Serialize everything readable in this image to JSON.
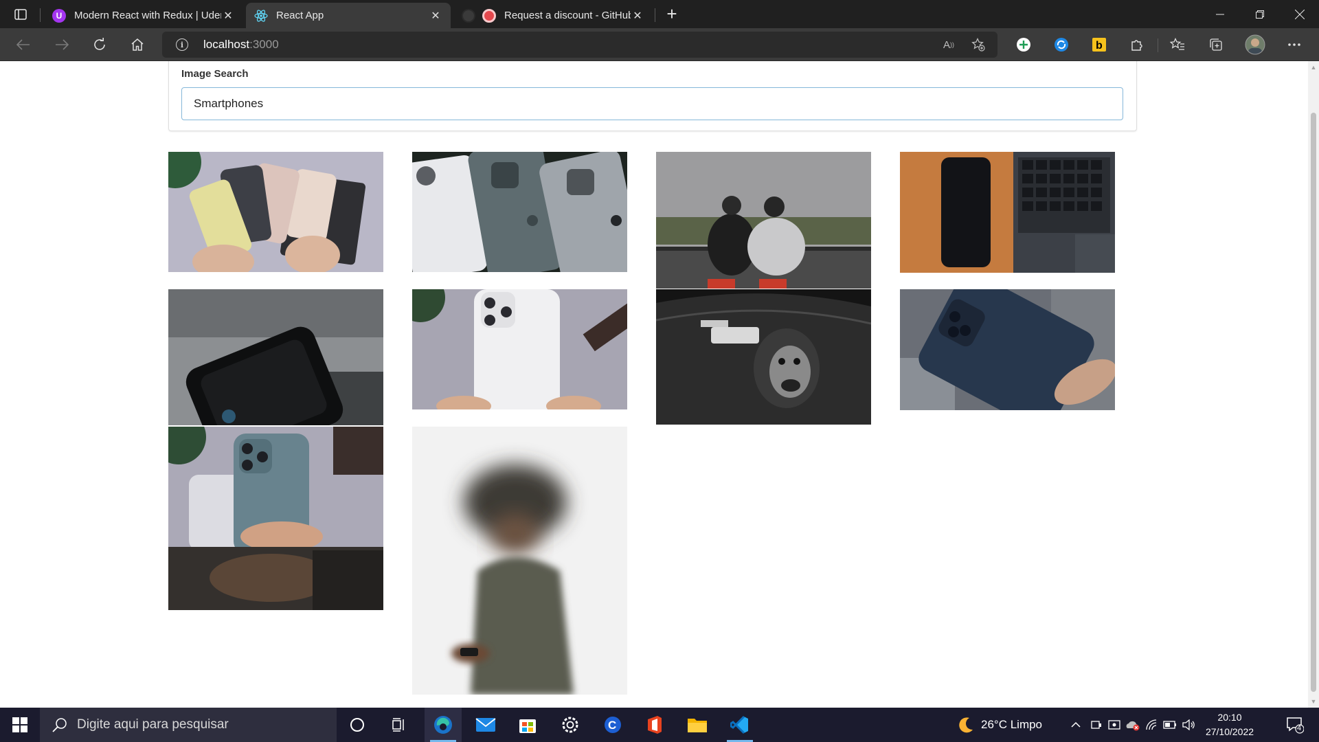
{
  "browser": {
    "tabs": [
      {
        "title": "Modern React with Redux | Udem",
        "favicon": "udemy-icon",
        "active": false
      },
      {
        "title": "React App",
        "favicon": "react-icon",
        "active": true
      },
      {
        "title": "Request a discount - GitHub",
        "favicon": "github-icon",
        "active": false
      }
    ],
    "new_tab_symbol": "+",
    "url_host": "localhost",
    "url_port": ":3000"
  },
  "app": {
    "search_label": "Image Search",
    "search_value": "Smartphones"
  },
  "images": [
    {
      "description": "three iphones held in hands",
      "palette": [
        "#b9b7c7",
        "#e4dea2",
        "#d9c6bd"
      ]
    },
    {
      "description": "silver and green iphone 11 pro backs",
      "palette": [
        "#1d2420",
        "#c9ccd0",
        "#5c6a6e"
      ]
    },
    {
      "description": "two people photographing a landscape",
      "palette": [
        "#a0a0a0",
        "#2b2b2b",
        "#4e5540"
      ]
    },
    {
      "description": "black phone on wooden desk next to laptop keyboard",
      "palette": [
        "#c57b3f",
        "#16181d",
        "#3c4047"
      ]
    },
    {
      "description": "smartphone with instagram profile on desk",
      "palette": [
        "#8a8e90",
        "#0f1011",
        "#474a4c"
      ]
    },
    {
      "description": "white iphone 11 pro held in hands",
      "palette": [
        "#a7a5b2",
        "#f2f2f2",
        "#2f3a2a"
      ]
    },
    {
      "description": "graffiti gorilla mural black and white",
      "palette": [
        "#1a1a1a",
        "#bfbfbf",
        "#555555"
      ]
    },
    {
      "description": "blue iphone 12 pro held in hand",
      "palette": [
        "#5e6470",
        "#2b3e58",
        "#8a8f96"
      ]
    },
    {
      "description": "iphone in teal case held in hand",
      "palette": [
        "#a9a7b6",
        "#68838e",
        "#d4d4dc"
      ]
    },
    {
      "description": "blurred man looking at his phone",
      "palette": [
        "#f2f2f2",
        "#4e4f47",
        "#202020"
      ]
    }
  ],
  "taskbar": {
    "search_placeholder": "Digite aqui para pesquisar",
    "weather": "26°C  Limpo",
    "time": "20:10",
    "date": "27/10/2022",
    "notifications_count": "4"
  }
}
